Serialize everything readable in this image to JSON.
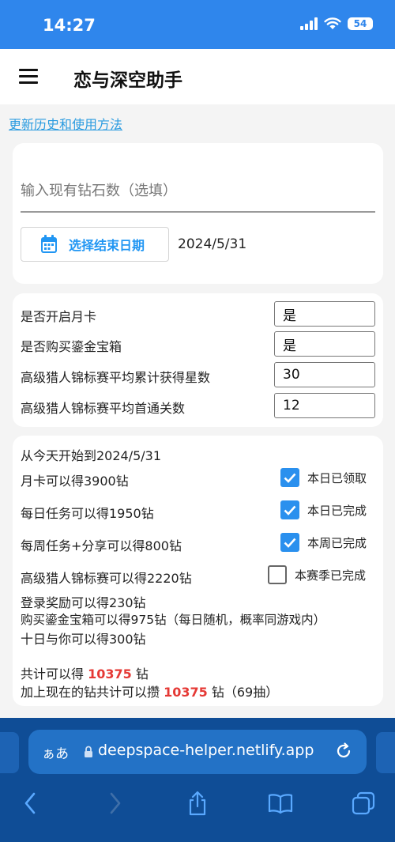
{
  "status": {
    "time": "14:27",
    "battery": "54"
  },
  "app": {
    "title": "恋与深空助手"
  },
  "links": {
    "update_history": "更新历史和使用方法"
  },
  "inputs": {
    "diamond_placeholder": "输入现有钻石数（选填）",
    "diamond_value": "",
    "date_button_label": "选择结束日期",
    "end_date": "2024/5/31"
  },
  "settings": [
    {
      "label": "是否开启月卡",
      "value": "是"
    },
    {
      "label": "是否购买鎏金宝箱",
      "value": "是"
    },
    {
      "label": "高级猎人锦标赛平均累计获得星数",
      "value": "30"
    },
    {
      "label": "高级猎人锦标赛平均首通关数",
      "value": "12"
    }
  ],
  "summary": {
    "heading": "从今天开始到2024/5/31",
    "items": [
      {
        "text": "月卡可以得3900钻",
        "check_label": "本日已领取",
        "checked": true
      },
      {
        "text": "每日任务可以得1950钻",
        "check_label": "本日已完成",
        "checked": true
      },
      {
        "text": "每周任务+分享可以得800钻",
        "check_label": "本周已完成",
        "checked": true
      },
      {
        "text": "高级猎人锦标赛可以得2220钻",
        "check_label": "本赛季已完成",
        "checked": false
      }
    ],
    "extra_lines": [
      "登录奖励可以得230钻",
      "购买鎏金宝箱可以得975钻（每日随机，概率同游戏内）",
      "十日与你可以得300钻"
    ],
    "total_prefix": "共计可以得 ",
    "total_value": "10375",
    "total_suffix": " 钻",
    "combined_prefix": "加上现在的钻共计可以攒 ",
    "combined_value": "10375",
    "combined_suffix": " 钻（69抽）"
  },
  "browser": {
    "aa_label": "ぁあ",
    "url": "deepspace-helper.netlify.app"
  },
  "colors": {
    "accent": "#2f86ec",
    "link": "#2a9be0",
    "highlight": "#e53935",
    "chrome": "#0f4d96"
  }
}
